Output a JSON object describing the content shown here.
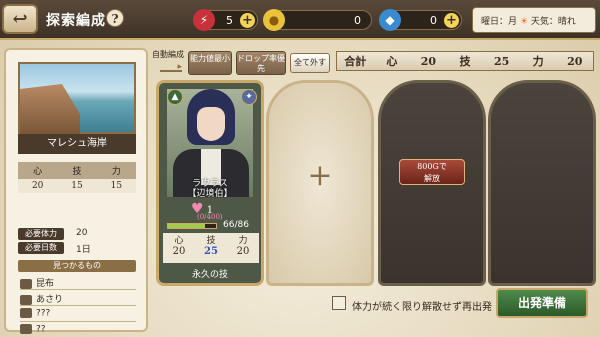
{
  "header": {
    "title": "探索編成",
    "help": "?"
  },
  "resources": {
    "stamina": "5",
    "coins": "0",
    "gems": "0",
    "stamina_icon": "lightning-icon",
    "coin_icon": "coin-icon",
    "gem_icon": "diamond-icon"
  },
  "weather": {
    "label": "曜日：月",
    "sun": "☀",
    "text": "天気：晴れ"
  },
  "location": {
    "name": "マレシュ海岸",
    "stats_headers": [
      "心",
      "技",
      "力"
    ],
    "stats_values": [
      "20",
      "15",
      "15"
    ],
    "req_stamina_label": "必要体力",
    "req_stamina": "20",
    "req_days_label": "必要日数",
    "req_days": "1日",
    "find_header": "見つかるもの",
    "finds": [
      "昆布",
      "あさり",
      "???",
      "??"
    ]
  },
  "formation": {
    "auto_label": "自動編成",
    "btn_stat": "能力値最小",
    "btn_drop": "ドロップ率優先",
    "btn_clear": "全て外す"
  },
  "totals": {
    "label": "合計",
    "h1": "心",
    "v1": "20",
    "h2": "技",
    "v2": "25",
    "h3": "力",
    "v3": "20"
  },
  "character": {
    "name_line1": "ラウラス",
    "name_line2": "【辺境伯】",
    "affinity": "1",
    "affinity_max": "(0/400)",
    "hp": "66/86",
    "hp_fill": 0.77,
    "stat_headers": [
      "心",
      "技",
      "力"
    ],
    "stat_values": [
      "20",
      "25",
      "20"
    ],
    "skill": "永久の技",
    "class_icon": "boot-icon",
    "element_icon": "swirl-icon"
  },
  "slots": {
    "unlock_line1": "800Gで",
    "unlock_line2": "解放"
  },
  "bottom": {
    "checkbox_label": "体力が続く限り解散せず再出発",
    "depart": "出発準備"
  },
  "colors": {
    "accent": "#c8a96a",
    "depart": "#3e7a3a",
    "unlock": "#8a3024"
  }
}
